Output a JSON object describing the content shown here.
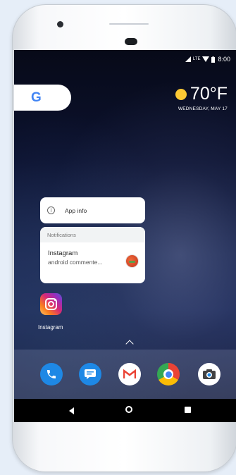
{
  "status_bar": {
    "network": "LTE",
    "time": "8:00"
  },
  "search_widget": {
    "letter": "G"
  },
  "weather": {
    "temperature": "70°F",
    "date": "WEDNESDAY, MAY 17"
  },
  "shortcut_menu": {
    "app_info_label": "App info",
    "notifications_header": "Notifications",
    "notification_title": "Instagram",
    "notification_text": "android commente..."
  },
  "home": {
    "app_label": "Instagram"
  },
  "dock": {
    "apps": [
      "phone-icon",
      "messages-icon",
      "gmail-icon",
      "chrome-icon",
      "camera-icon"
    ]
  },
  "colors": {
    "google_blue": "#4285f4",
    "sun": "#fcc934"
  }
}
